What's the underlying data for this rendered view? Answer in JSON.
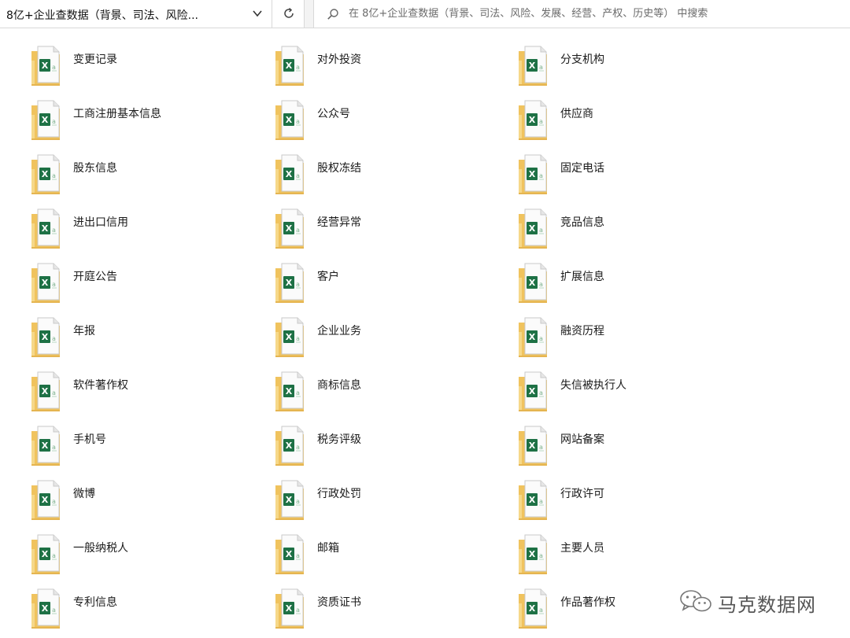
{
  "address_bar": {
    "path_text": "8亿+企业查数据（背景、司法、风险..."
  },
  "search": {
    "placeholder": "在 8亿+企业查数据（背景、司法、风险、发展、经营、产权、历史等） 中搜索"
  },
  "icons": {
    "chevron": "chevron-down-icon",
    "refresh": "refresh-icon",
    "search": "search-icon",
    "file": "excel-file-icon",
    "watermark": "wechat-logo-icon"
  },
  "colors": {
    "folder": "#f5d27a",
    "excel_green": "#1e7145"
  },
  "files": [
    {
      "label": "变更记录"
    },
    {
      "label": "对外投资"
    },
    {
      "label": "分支机构"
    },
    {
      "label": "工商注册基本信息"
    },
    {
      "label": "公众号"
    },
    {
      "label": "供应商"
    },
    {
      "label": "股东信息"
    },
    {
      "label": "股权冻结"
    },
    {
      "label": "固定电话"
    },
    {
      "label": "进出口信用"
    },
    {
      "label": "经营异常"
    },
    {
      "label": "竞品信息"
    },
    {
      "label": "开庭公告"
    },
    {
      "label": "客户"
    },
    {
      "label": "扩展信息"
    },
    {
      "label": "年报"
    },
    {
      "label": "企业业务"
    },
    {
      "label": "融资历程"
    },
    {
      "label": "软件著作权"
    },
    {
      "label": "商标信息"
    },
    {
      "label": "失信被执行人"
    },
    {
      "label": "手机号"
    },
    {
      "label": "税务评级"
    },
    {
      "label": "网站备案"
    },
    {
      "label": "微博"
    },
    {
      "label": "行政处罚"
    },
    {
      "label": "行政许可"
    },
    {
      "label": "一般纳税人"
    },
    {
      "label": "邮箱"
    },
    {
      "label": "主要人员"
    },
    {
      "label": "专利信息"
    },
    {
      "label": "资质证书"
    },
    {
      "label": "作品著作权"
    }
  ],
  "watermark": {
    "text": "马克数据网"
  }
}
